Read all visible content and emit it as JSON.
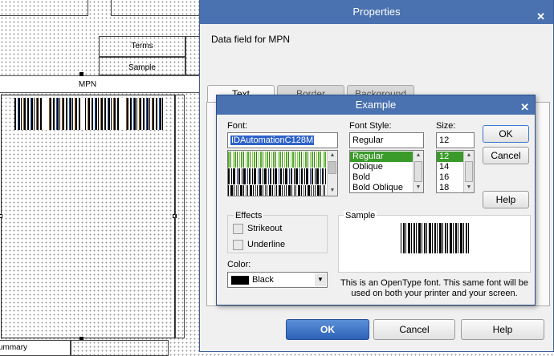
{
  "canvas": {
    "terms_label": "Terms",
    "sample_label": "Sample",
    "mpn_label": "MPN",
    "summary_label": "ummary"
  },
  "properties": {
    "title": "Properties",
    "description": "Data field for MPN",
    "tabs": [
      "Text",
      "Border",
      "Background"
    ],
    "buttons": {
      "ok": "OK",
      "cancel": "Cancel",
      "help": "Help"
    }
  },
  "example": {
    "title": "Example",
    "font_label": "Font:",
    "font_value": "IDAutomationC128M",
    "style_label": "Font Style:",
    "style_value": "Regular",
    "styles": [
      "Regular",
      "Oblique",
      "Bold",
      "Bold Oblique"
    ],
    "selected_style_index": 0,
    "size_label": "Size:",
    "size_value": "12",
    "sizes": [
      "12",
      "14",
      "16",
      "18"
    ],
    "selected_size_index": 0,
    "effects_label": "Effects",
    "strikeout_label": "Strikeout",
    "underline_label": "Underline",
    "strikeout_checked": false,
    "underline_checked": false,
    "color_label": "Color:",
    "color_value": "Black",
    "color_hex": "#000000",
    "sample_label": "Sample",
    "note": "This is an OpenType font. This same font will be used on both your printer and your screen.",
    "buttons": {
      "ok": "OK",
      "cancel": "Cancel",
      "help": "Help"
    },
    "icons": {
      "close": "close-icon",
      "scroll_up": "chevron-up-icon",
      "scroll_down": "chevron-down-icon",
      "dropdown": "chevron-down-icon"
    }
  },
  "colors": {
    "title_bar": "#4a72b0",
    "selection_green": "#3a9a2a",
    "primary_button": "#2d62b8"
  }
}
